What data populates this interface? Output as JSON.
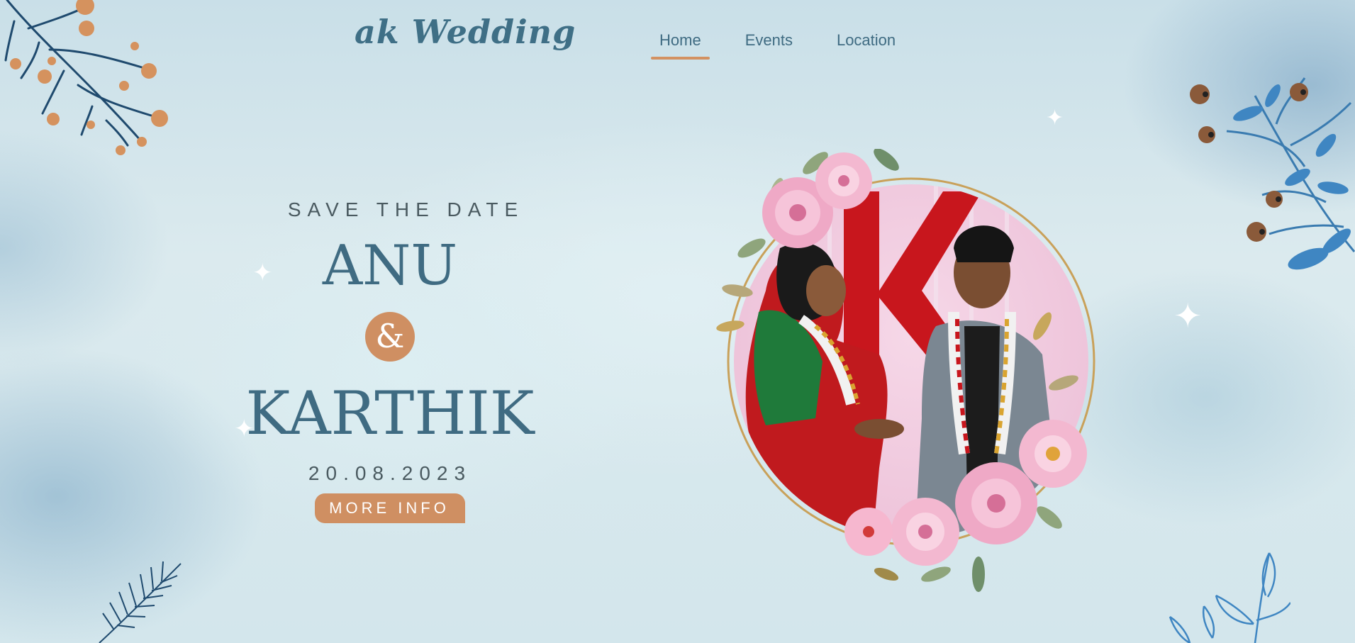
{
  "header": {
    "logo": "ak Wedding",
    "nav": [
      {
        "label": "Home",
        "active": true
      },
      {
        "label": "Events",
        "active": false
      },
      {
        "label": "Location",
        "active": false
      }
    ]
  },
  "hero": {
    "tagline": "SAVE THE DATE",
    "bride": "ANU",
    "ampersand": "&",
    "groom": "KARTHIK",
    "date": "20.08.2023",
    "button_label": "MORE INFO"
  },
  "colors": {
    "accent": "#cf8f62",
    "primary_text": "#3f6b82",
    "background": "#d6e8ee"
  },
  "icons": [
    "sparkle-icon",
    "branch-decoration",
    "leaf-decoration",
    "floral-frame"
  ]
}
